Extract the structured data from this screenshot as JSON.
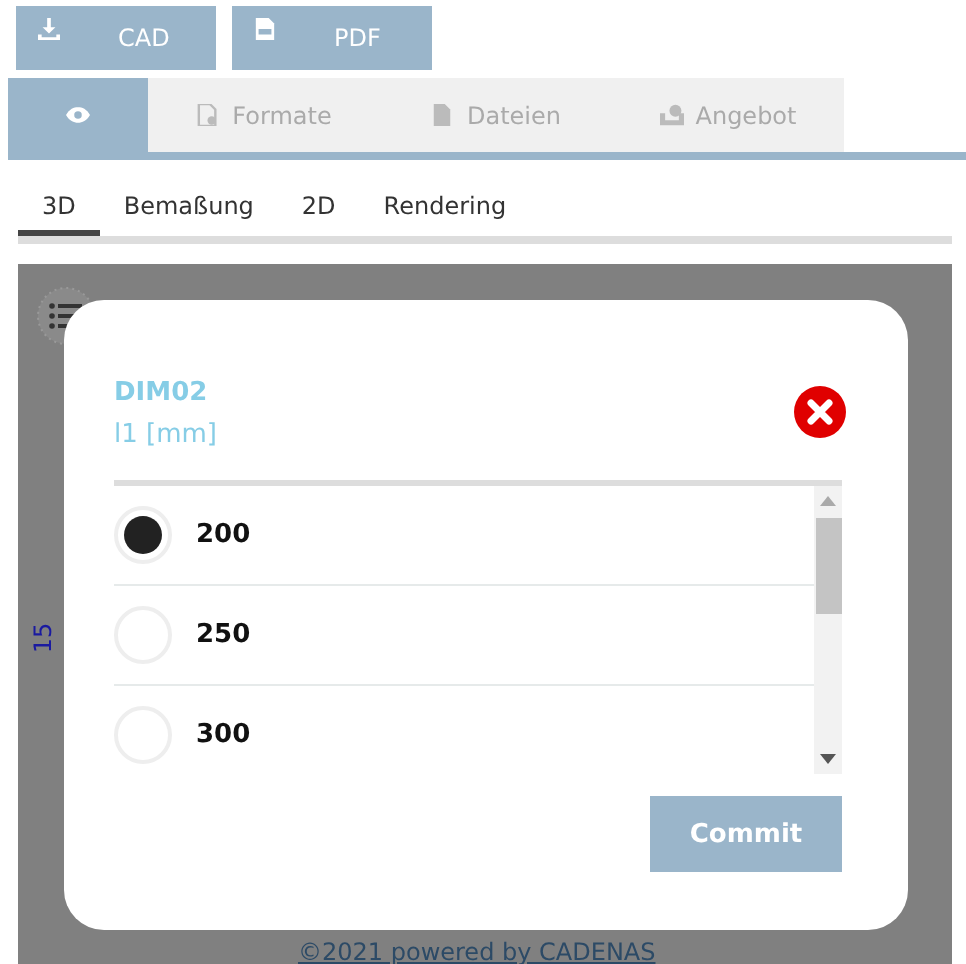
{
  "top_buttons": [
    {
      "label": "CAD",
      "kind": "download"
    },
    {
      "label": "PDF",
      "kind": "pdf"
    }
  ],
  "tabs": [
    {
      "kind": "view",
      "selected": true
    },
    {
      "label": "Formate",
      "kind": "formats",
      "selected": false
    },
    {
      "label": "Dateien",
      "kind": "files",
      "selected": false
    },
    {
      "label": "Angebot",
      "kind": "quote",
      "selected": false
    }
  ],
  "view_tabs": [
    {
      "label": "3D",
      "selected": true
    },
    {
      "label": "Bemaßung",
      "selected": false
    },
    {
      "label": "2D",
      "selected": false
    },
    {
      "label": "Rendering",
      "selected": false
    }
  ],
  "viewer": {
    "dimension_label": "15"
  },
  "dialog": {
    "title": "DIM02",
    "subtitle": "l1  [mm]",
    "options": [
      {
        "label": "200",
        "selected": true
      },
      {
        "label": "250",
        "selected": false
      },
      {
        "label": "300",
        "selected": false
      }
    ],
    "commit": "Commit"
  },
  "footer": {
    "link": "©2021 powered by CADENAS"
  }
}
